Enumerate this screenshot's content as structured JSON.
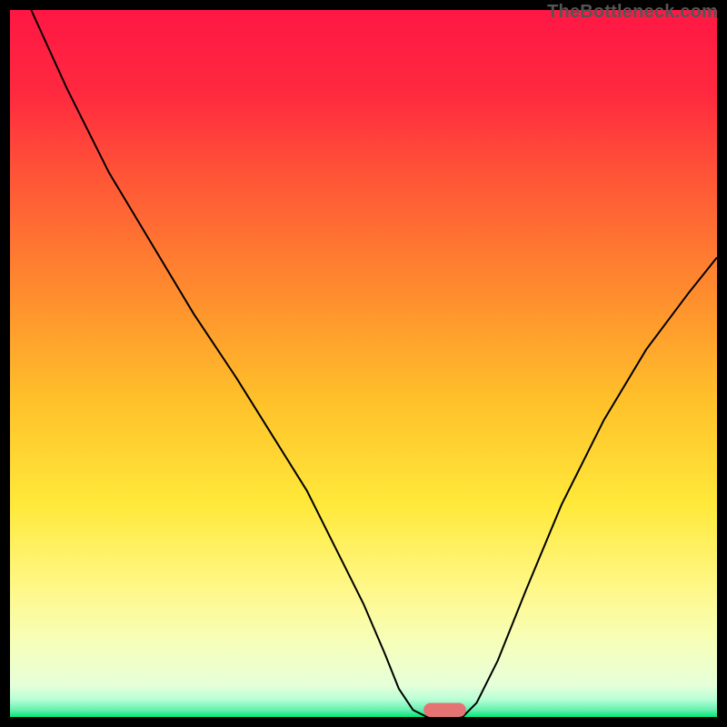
{
  "watermark": "TheBottleneck.com",
  "chart_data": {
    "type": "line",
    "title": "",
    "xlabel": "",
    "ylabel": "",
    "xlim": [
      0,
      100
    ],
    "ylim": [
      0,
      100
    ],
    "grid": false,
    "legend": false,
    "background": {
      "type": "gradient",
      "stops": [
        {
          "pos": 0.0,
          "color": "#ff1744"
        },
        {
          "pos": 0.12,
          "color": "#ff2a3f"
        },
        {
          "pos": 0.25,
          "color": "#ff5a36"
        },
        {
          "pos": 0.4,
          "color": "#ff8c2e"
        },
        {
          "pos": 0.55,
          "color": "#ffc02a"
        },
        {
          "pos": 0.7,
          "color": "#ffe93a"
        },
        {
          "pos": 0.82,
          "color": "#fff88a"
        },
        {
          "pos": 0.9,
          "color": "#f5ffbd"
        },
        {
          "pos": 0.955,
          "color": "#e6ffd9"
        },
        {
          "pos": 0.975,
          "color": "#b8ffd6"
        },
        {
          "pos": 0.99,
          "color": "#66f0b0"
        },
        {
          "pos": 1.0,
          "color": "#00e676"
        }
      ]
    },
    "series": [
      {
        "name": "bottleneck-curve",
        "color": "#000000",
        "x": [
          3,
          8,
          14,
          20,
          26,
          32,
          37,
          42,
          46,
          50,
          53,
          55,
          57,
          59,
          60,
          64,
          66,
          69,
          73,
          78,
          84,
          90,
          96,
          100
        ],
        "y": [
          100,
          89,
          77,
          67,
          57,
          48,
          40,
          32,
          24,
          16,
          9,
          4,
          1,
          0,
          0,
          0,
          2,
          8,
          18,
          30,
          42,
          52,
          60,
          65
        ]
      }
    ],
    "marker": {
      "name": "optimal-zone",
      "shape": "pill",
      "color": "#e57373",
      "x_center": 61.5,
      "y": 0,
      "width": 6,
      "height": 2
    }
  }
}
